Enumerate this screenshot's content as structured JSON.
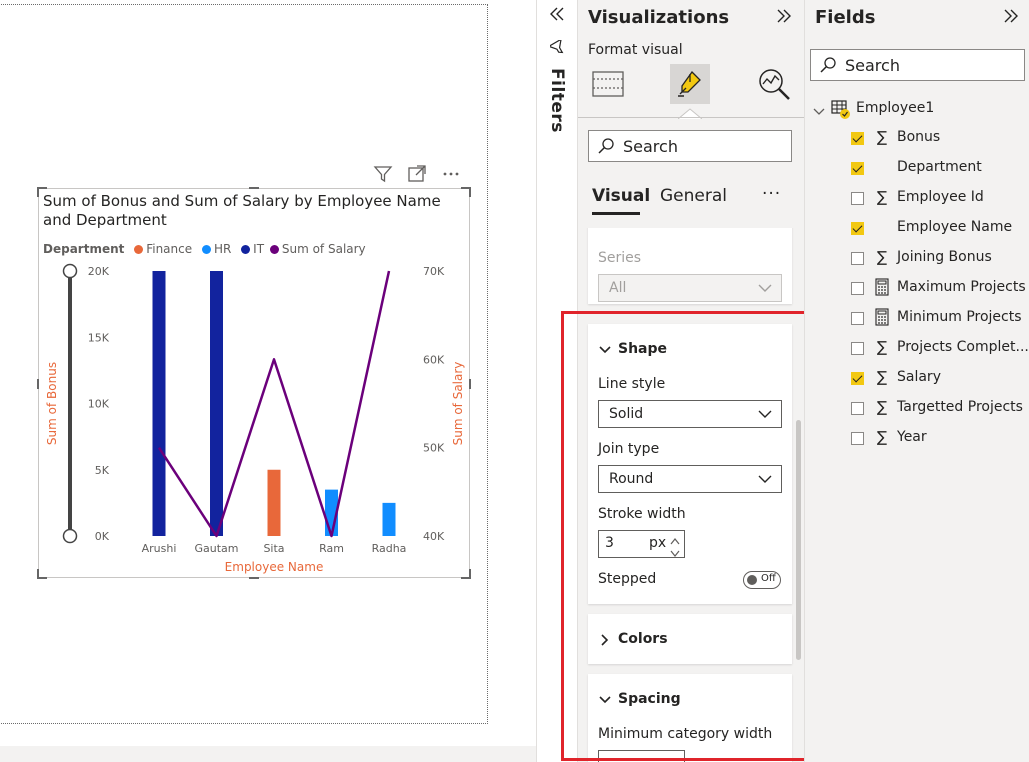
{
  "chart": {
    "title": "Sum of Bonus and Sum of Salary by Employee Name and Department",
    "legend_title": "Department",
    "legend": [
      {
        "label": "Finance",
        "color": "#e8683a"
      },
      {
        "label": "HR",
        "color": "#118dff"
      },
      {
        "label": "IT",
        "color": "#12239e"
      },
      {
        "label": "Sum of Salary",
        "color": "#6b007b"
      }
    ]
  },
  "chart_data": {
    "type": "bar",
    "categories": [
      "Arushi",
      "Gautam",
      "Sita",
      "Ram",
      "Radha"
    ],
    "bar_series": [
      {
        "name": "Finance",
        "color": "#e8683a",
        "values": [
          0,
          0,
          5000,
          0,
          0
        ]
      },
      {
        "name": "HR",
        "color": "#118dff",
        "values": [
          0,
          0,
          0,
          3500,
          2500
        ]
      },
      {
        "name": "IT",
        "color": "#12239e",
        "values": [
          20000,
          20000,
          0,
          0,
          0
        ]
      }
    ],
    "line_series": {
      "name": "Sum of Salary",
      "color": "#6b007b",
      "values": [
        50000,
        40000,
        60000,
        40000,
        70000
      ]
    },
    "y_left": {
      "label": "Sum of Bonus",
      "ticks": [
        "0K",
        "5K",
        "10K",
        "15K",
        "20K"
      ],
      "range": [
        0,
        20000
      ]
    },
    "y_right": {
      "label": "Sum of Salary",
      "ticks": [
        "40K",
        "50K",
        "60K",
        "70K"
      ],
      "range": [
        40000,
        70000
      ]
    },
    "xlabel": "Employee Name",
    "axis_label_color": "#e8683a"
  },
  "filters": {
    "label": "Filters"
  },
  "viz": {
    "title": "Visualizations",
    "subtitle": "Format visual",
    "search_placeholder": "Search",
    "tabs": {
      "visual": "Visual",
      "general": "General",
      "more": "···"
    },
    "series": {
      "label": "Series",
      "value": "All"
    },
    "shape": {
      "title": "Shape",
      "line_style_label": "Line style",
      "line_style_value": "Solid",
      "join_type_label": "Join type",
      "join_type_value": "Round",
      "stroke_width_label": "Stroke width",
      "stroke_width_value": "3",
      "stroke_width_unit": "px",
      "stepped_label": "Stepped",
      "stepped_toggle": "Off"
    },
    "colors": {
      "title": "Colors"
    },
    "spacing": {
      "title": "Spacing",
      "min_category_width_label": "Minimum category width"
    }
  },
  "fields": {
    "title": "Fields",
    "search_placeholder": "Search",
    "table_name": "Employee1",
    "items": [
      {
        "name": "Bonus",
        "checked": true,
        "icon": "sigma"
      },
      {
        "name": "Department",
        "checked": true,
        "icon": "none"
      },
      {
        "name": "Employee Id",
        "checked": false,
        "icon": "sigma"
      },
      {
        "name": "Employee Name",
        "checked": true,
        "icon": "none"
      },
      {
        "name": "Joining Bonus",
        "checked": false,
        "icon": "sigma"
      },
      {
        "name": "Maximum Projects",
        "checked": false,
        "icon": "calculator"
      },
      {
        "name": "Minimum Projects",
        "checked": false,
        "icon": "calculator"
      },
      {
        "name": "Projects Complet...",
        "checked": false,
        "icon": "sigma"
      },
      {
        "name": "Salary",
        "checked": true,
        "icon": "sigma"
      },
      {
        "name": "Targetted Projects",
        "checked": false,
        "icon": "sigma"
      },
      {
        "name": "Year",
        "checked": false,
        "icon": "sigma"
      }
    ]
  }
}
